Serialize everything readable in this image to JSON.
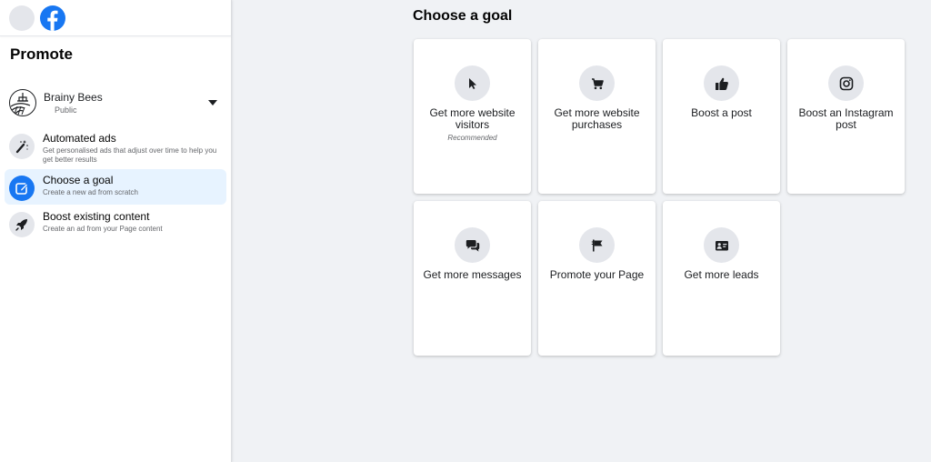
{
  "sidebar": {
    "title": "Promote",
    "page": {
      "name": "Brainy Bees",
      "visibility": "Public"
    },
    "items": [
      {
        "label": "Automated ads",
        "description": "Get personalised ads that adjust over time to help you get better results",
        "icon": "magic-wand-icon",
        "active": false
      },
      {
        "label": "Choose a goal",
        "description": "Create a new ad from scratch",
        "icon": "edit-icon",
        "active": true
      },
      {
        "label": "Boost existing content",
        "description": "Create an ad from your Page content",
        "icon": "rocket-icon",
        "active": false
      }
    ]
  },
  "main": {
    "title": "Choose a goal",
    "goals": [
      {
        "label": "Get more website visitors",
        "sublabel": "Recommended",
        "icon": "cursor-icon"
      },
      {
        "label": "Get more website purchases",
        "sublabel": "",
        "icon": "shopping-cart-icon"
      },
      {
        "label": "Boost a post",
        "sublabel": "",
        "icon": "thumbs-up-icon"
      },
      {
        "label": "Boost an Instagram post",
        "sublabel": "",
        "icon": "instagram-icon"
      },
      {
        "label": "Get more messages",
        "sublabel": "",
        "icon": "chat-bubbles-icon"
      },
      {
        "label": "Promote your Page",
        "sublabel": "",
        "icon": "flag-icon"
      },
      {
        "label": "Get more leads",
        "sublabel": "",
        "icon": "contact-card-icon"
      }
    ]
  },
  "colors": {
    "brand": "#1877f2",
    "active_bg": "#e7f3ff",
    "background": "#f0f2f5",
    "icon_bg": "#e4e6eb"
  }
}
